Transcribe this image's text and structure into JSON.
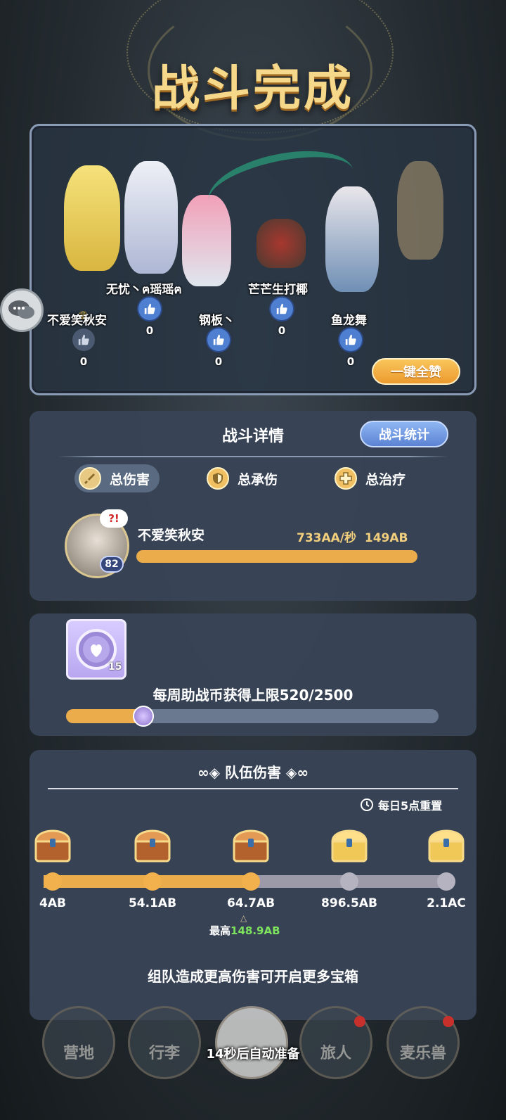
{
  "title": "战斗完成",
  "team": {
    "members": [
      {
        "name": "不爱笑秋安",
        "likes": "0",
        "crown": true
      },
      {
        "name": "无忧丶ฅ瑶瑶ฅ",
        "likes": "0"
      },
      {
        "name": "钢板丶",
        "likes": "0"
      },
      {
        "name": "芒芒生打椰",
        "likes": "0"
      },
      {
        "name": "鱼龙舞",
        "likes": "0"
      }
    ],
    "like_all_label": "一键全赞"
  },
  "battle_details": {
    "title": "战斗详情",
    "stats_button": "战斗统计",
    "tabs": [
      {
        "label": "总伤害",
        "active": true,
        "icon": "sword-icon"
      },
      {
        "label": "总承伤",
        "active": false,
        "icon": "shield-icon"
      },
      {
        "label": "总治疗",
        "active": false,
        "icon": "cross-icon"
      }
    ],
    "top_player": {
      "name": "不爱笑秋安",
      "level": "82",
      "speech": "?!",
      "dps": "733AA/秒",
      "total": "149AB",
      "bar_fraction": 1.0
    }
  },
  "coin": {
    "count": "15",
    "limit_text": "每周助战币获得上限520/2500",
    "progress": 0.208
  },
  "team_damage": {
    "title": "队伍伤害",
    "reset_text": "每日5点重置",
    "tiers": [
      {
        "label": "4AB",
        "reached": true,
        "chest": "bronze"
      },
      {
        "label": "54.1AB",
        "reached": true,
        "chest": "bronze"
      },
      {
        "label": "64.7AB",
        "reached": true,
        "chest": "bronze"
      },
      {
        "label": "896.5AB",
        "reached": false,
        "chest": "gold"
      },
      {
        "label": "2.1AC",
        "reached": false,
        "chest": "gold"
      }
    ],
    "best_label": "最高",
    "best_value": "148.9AB",
    "hint": "组队造成更高伤害可开启更多宝箱"
  },
  "bottom_nav": {
    "items": [
      "营地",
      "行李",
      "",
      "旅人",
      "麦乐兽"
    ],
    "auto_ready": "14秒后自动准备"
  },
  "colors": {
    "accent_orange": "#ebad4b",
    "like_blue": "#4f7fd0",
    "best_green": "#7de35e"
  }
}
